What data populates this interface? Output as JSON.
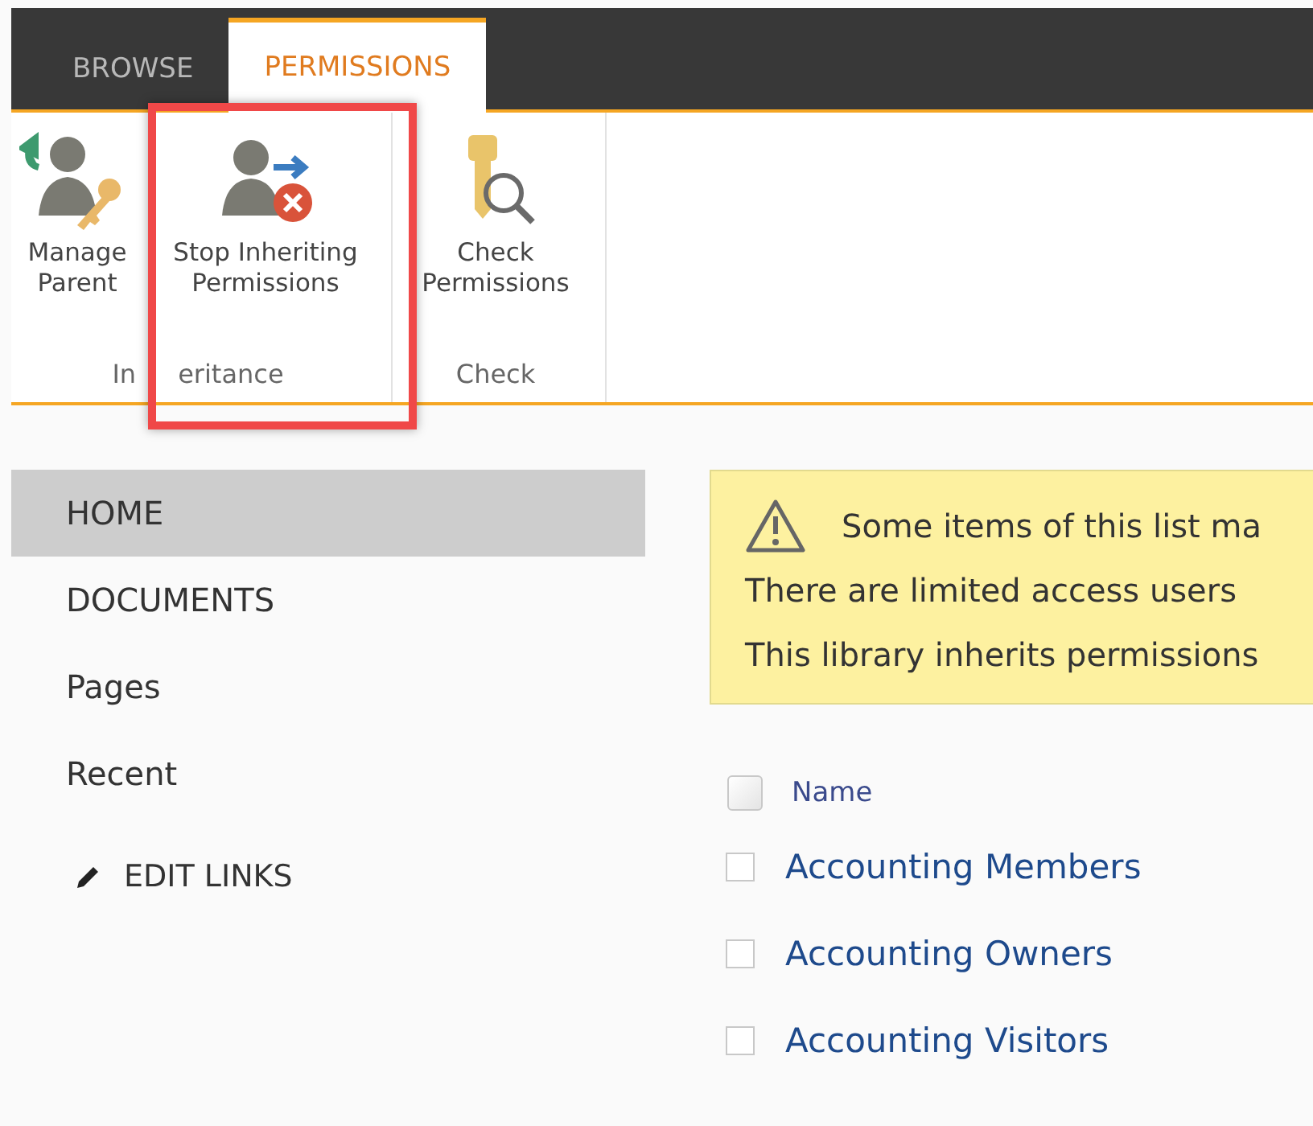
{
  "ribbon_tabs": [
    {
      "label": "BROWSE",
      "selected": false
    },
    {
      "label": "PERMISSIONS",
      "selected": true
    }
  ],
  "ribbon_groups": [
    {
      "label_parts": [
        "In",
        "eritance"
      ],
      "buttons": [
        {
          "kind": "manage",
          "label": "Manage Parent",
          "highlighted": false
        },
        {
          "kind": "stop",
          "label": "Stop Inheriting Permissions",
          "highlighted": true
        }
      ]
    },
    {
      "label_parts": [
        "Check"
      ],
      "buttons": [
        {
          "kind": "check",
          "label": "Check Permissions",
          "highlighted": false
        }
      ]
    }
  ],
  "nav": {
    "items": [
      {
        "label": "HOME",
        "selected": true
      },
      {
        "label": "DOCUMENTS",
        "selected": false
      },
      {
        "label": "Pages",
        "selected": false
      },
      {
        "label": "Recent",
        "selected": false
      }
    ],
    "edit_links": "EDIT LINKS"
  },
  "notice": {
    "lines": [
      "Some items of this list ma",
      "There are limited access users",
      "This library inherits permissions"
    ]
  },
  "list": {
    "header": {
      "label": "Name",
      "checked": false
    },
    "rows": [
      {
        "name": "Accounting Members",
        "checked": false
      },
      {
        "name": "Accounting Owners",
        "checked": false
      },
      {
        "name": "Accounting Visitors",
        "checked": false
      }
    ]
  }
}
